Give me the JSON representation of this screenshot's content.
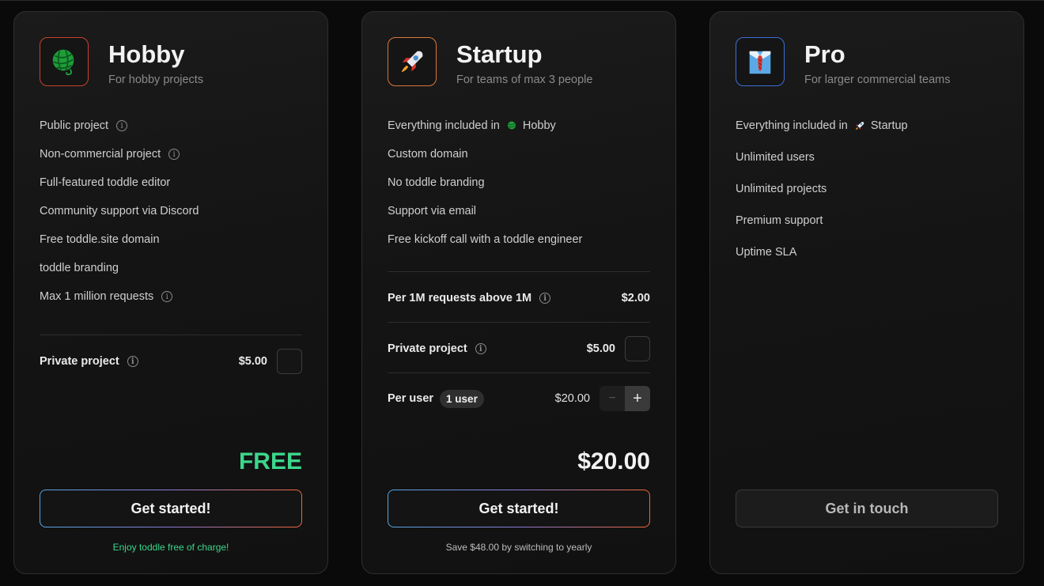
{
  "plans": {
    "hobby": {
      "title": "Hobby",
      "subtitle": "For hobby projects",
      "icon": "yarn-ball-icon",
      "features": [
        "Public project",
        "Non-commercial project",
        "Full-featured toddle editor",
        "Community support via Discord",
        "Free toddle.site domain",
        "toddle branding",
        "Max 1 million requests"
      ],
      "addons": [
        {
          "label": "Private project",
          "price": "$5.00",
          "checked": false
        }
      ],
      "total": "FREE",
      "cta": "Get started!",
      "note": "Enjoy toddle free of charge!"
    },
    "startup": {
      "title": "Startup",
      "subtitle": "For teams of max 3 people",
      "icon": "rocket-icon",
      "features": [
        "Everything included in",
        "Hobby",
        "Custom domain",
        "No toddle branding",
        "Support via email",
        "Free kickoff call with a toddle engineer"
      ],
      "addons": [
        {
          "label": "Per 1M requests above 1M",
          "price": "$2.00"
        },
        {
          "label": "Private project",
          "price": "$5.00",
          "checked": false
        },
        {
          "label": "Per user",
          "pill": "1 user",
          "price": "$20.00",
          "stepper_minus": "−",
          "stepper_plus": "+"
        }
      ],
      "total": "$20.00",
      "cta": "Get started!",
      "note": "Save $48.00 by switching to yearly"
    },
    "pro": {
      "title": "Pro",
      "subtitle": "For larger commercial teams",
      "icon": "shirt-and-tie-icon",
      "features": [
        "Everything included in",
        "Startup",
        "Unlimited users",
        "Unlimited projects",
        "Premium support",
        "Uptime SLA"
      ],
      "cta": "Get in touch"
    }
  },
  "info_glyph": "i",
  "colors": {
    "free_green": "#3dd68c",
    "gradient_start": "#55a6e6",
    "gradient_end": "#f0663a",
    "card_border": "#2e2e2e"
  }
}
